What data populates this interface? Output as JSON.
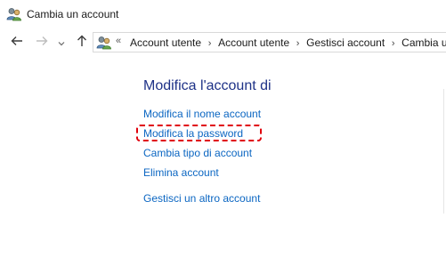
{
  "window": {
    "title": "Cambia un account",
    "title_icon": "user-accounts-icon"
  },
  "navigation": {
    "back_icon": "arrow-left-icon",
    "forward_icon": "arrow-right-icon",
    "recent_icon": "chevron-down-icon",
    "up_icon": "arrow-up-icon"
  },
  "address_bar": {
    "icon": "user-accounts-icon",
    "overflow": "«",
    "separator": "›",
    "crumbs": [
      "Account utente",
      "Account utente",
      "Gestisci account",
      "Cambia un account"
    ]
  },
  "main": {
    "heading": "Modifica l'account di",
    "links": {
      "rename": "Modifica il nome account",
      "password": "Modifica la password",
      "type": "Cambia tipo di account",
      "delete": "Elimina account",
      "other": "Gestisci un altro account"
    },
    "highlight_color": "#e0000b",
    "link_color": "#0b66c2",
    "heading_color": "#1e3287"
  }
}
